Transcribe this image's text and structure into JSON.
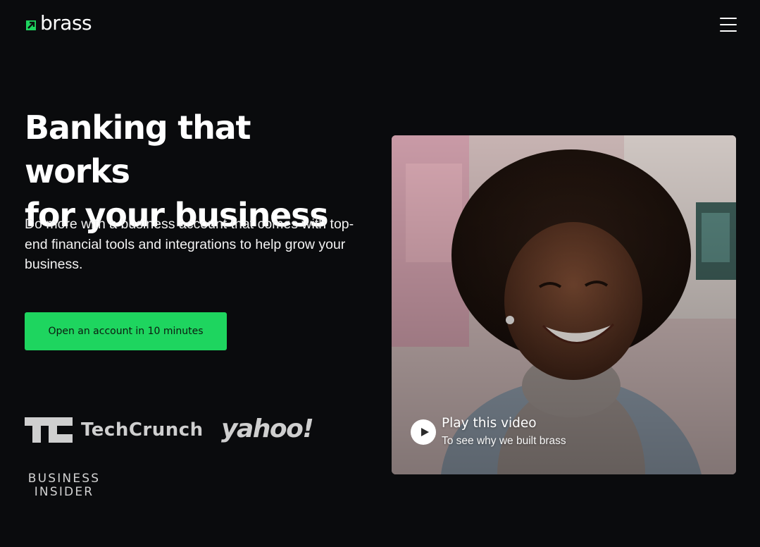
{
  "brand": {
    "name": "brass",
    "accent_color": "#1ed55f",
    "background": "#0a0b0d"
  },
  "header": {
    "menu_icon": "hamburger-menu-icon"
  },
  "hero": {
    "headline_line1": "Banking that works",
    "headline_line2": "for your business",
    "subtext": "Do more with a business account that comes with top-end financial tools and integrations to help grow your business.",
    "cta_label": "Open an account in 10 minutes"
  },
  "press": {
    "techcrunch": "TechCrunch",
    "yahoo": "yahoo!",
    "business_insider_line1": "BUSINESS",
    "business_insider_line2": "INSIDER"
  },
  "video": {
    "play_icon": "play-icon",
    "title": "Play this video",
    "subtitle": "To see why we built brass"
  }
}
